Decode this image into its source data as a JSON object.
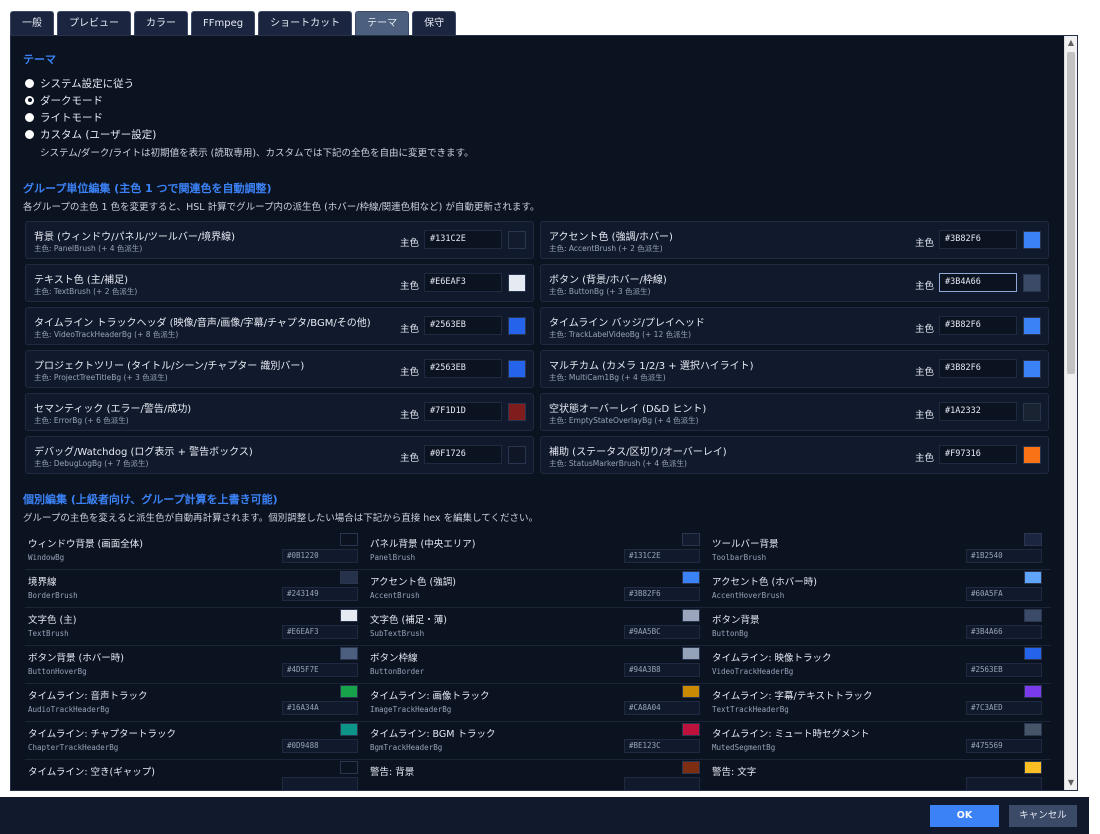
{
  "tabs": [
    {
      "label": "一般"
    },
    {
      "label": "プレビュー"
    },
    {
      "label": "カラー"
    },
    {
      "label": "FFmpeg"
    },
    {
      "label": "ショートカット"
    },
    {
      "label": "テーマ",
      "active": true
    },
    {
      "label": "保守"
    }
  ],
  "theme": {
    "title": "テーマ",
    "options": [
      {
        "label": "システム設定に従う",
        "checked": false
      },
      {
        "label": "ダークモード",
        "checked": true
      },
      {
        "label": "ライトモード",
        "checked": false
      },
      {
        "label": "カスタム (ユーザー設定)",
        "checked": false
      }
    ],
    "note": "システム/ダーク/ライトは初期値を表示 (読取専用)、カスタムでは下記の全色を自由に変更できます。"
  },
  "group_edit": {
    "title": "グループ単位編集 (主色 1 つで関連色を自動調整)",
    "desc": "各グループの主色 1 色を変更すると、HSL 計算でグループ内の派生色 (ホバー/枠線/関連色相など) が自動更新されます。",
    "primary_label": "主色",
    "groups": [
      {
        "title": "背景 (ウィンドウ/パネル/ツールバー/境界線)",
        "sub": "主色: PanelBrush (+ 4 色派生)",
        "hex": "#131C2E",
        "color": "#131C2E"
      },
      {
        "title": "アクセント色 (強調/ホバー)",
        "sub": "主色: AccentBrush (+ 2 色派生)",
        "hex": "#3B82F6",
        "color": "#3B82F6"
      },
      {
        "title": "テキスト色 (主/補足)",
        "sub": "主色: TextBrush (+ 2 色派生)",
        "hex": "#E6EAF3",
        "color": "#E6EAF3"
      },
      {
        "title": "ボタン (背景/ホバー/枠線)",
        "sub": "主色: ButtonBg (+ 3 色派生)",
        "hex": "#3B4A66",
        "color": "#3B4A66",
        "focused": true
      },
      {
        "title": "タイムライン トラックヘッダ (映像/音声/画像/字幕/チャプタ/BGM/その他)",
        "sub": "主色: VideoTrackHeaderBg (+ 8 色派生)",
        "hex": "#2563EB",
        "color": "#2563EB"
      },
      {
        "title": "タイムライン バッジ/プレイヘッド",
        "sub": "主色: TrackLabelVideoBg (+ 12 色派生)",
        "hex": "#3B82F6",
        "color": "#3B82F6"
      },
      {
        "title": "プロジェクトツリー (タイトル/シーン/チャプター 識別バー)",
        "sub": "主色: ProjectTreeTitleBg (+ 3 色派生)",
        "hex": "#2563EB",
        "color": "#2563EB"
      },
      {
        "title": "マルチカム (カメラ 1/2/3 + 選択ハイライト)",
        "sub": "主色: MultiCam1Bg (+ 4 色派生)",
        "hex": "#3B82F6",
        "color": "#3B82F6"
      },
      {
        "title": "セマンティック (エラー/警告/成功)",
        "sub": "主色: ErrorBg (+ 6 色派生)",
        "hex": "#7F1D1D",
        "color": "#7F1D1D"
      },
      {
        "title": "空状態オーバーレイ (D&D ヒント)",
        "sub": "主色: EmptyStateOverlayBg (+ 4 色派生)",
        "hex": "#1A2332",
        "color": "#1A2332"
      },
      {
        "title": "デバッグ/Watchdog (ログ表示 + 警告ボックス)",
        "sub": "主色: DebugLogBg (+ 7 色派生)",
        "hex": "#0F1726",
        "color": "#0F1726"
      },
      {
        "title": "補助 (ステータス/区切り/オーバーレイ)",
        "sub": "主色: StatusMarkerBrush (+ 4 色派生)",
        "hex": "#F97316",
        "color": "#F97316"
      }
    ]
  },
  "individual": {
    "title": "個別編集 (上級者向け、グループ計算を上書き可能)",
    "desc": "グループの主色を変えると派生色が自動再計算されます。個別調整したい場合は下記から直接 hex を編集してください。",
    "items": [
      {
        "name": "ウィンドウ背景 (画面全体)",
        "key": "WindowBg",
        "hex": "#0B1220",
        "color": "#0B1220"
      },
      {
        "name": "パネル背景 (中央エリア)",
        "key": "PanelBrush",
        "hex": "#131C2E",
        "color": "#131C2E"
      },
      {
        "name": "ツールバー背景",
        "key": "ToolbarBrush",
        "hex": "#1B2540",
        "color": "#1B2540"
      },
      {
        "name": "境界線",
        "key": "BorderBrush",
        "hex": "#243149",
        "color": "#243149"
      },
      {
        "name": "アクセント色 (強調)",
        "key": "AccentBrush",
        "hex": "#3B82F6",
        "color": "#3B82F6"
      },
      {
        "name": "アクセント色 (ホバー時)",
        "key": "AccentHoverBrush",
        "hex": "#60A5FA",
        "color": "#60A5FA"
      },
      {
        "name": "文字色 (主)",
        "key": "TextBrush",
        "hex": "#E6EAF3",
        "color": "#E6EAF3"
      },
      {
        "name": "文字色 (補足・薄)",
        "key": "SubTextBrush",
        "hex": "#9AA5BC",
        "color": "#9AA5BC"
      },
      {
        "name": "ボタン背景",
        "key": "ButtonBg",
        "hex": "#3B4A66",
        "color": "#3B4A66"
      },
      {
        "name": "ボタン背景 (ホバー時)",
        "key": "ButtonHoverBg",
        "hex": "#4D5F7E",
        "color": "#4D5F7E"
      },
      {
        "name": "ボタン枠線",
        "key": "ButtonBorder",
        "hex": "#94A3B8",
        "color": "#94A3B8"
      },
      {
        "name": "タイムライン: 映像トラック",
        "key": "VideoTrackHeaderBg",
        "hex": "#2563EB",
        "color": "#2563EB"
      },
      {
        "name": "タイムライン: 音声トラック",
        "key": "AudioTrackHeaderBg",
        "hex": "#16A34A",
        "color": "#16A34A"
      },
      {
        "name": "タイムライン: 画像トラック",
        "key": "ImageTrackHeaderBg",
        "hex": "#CA8A04",
        "color": "#CA8A04"
      },
      {
        "name": "タイムライン: 字幕/テキストトラック",
        "key": "TextTrackHeaderBg",
        "hex": "#7C3AED",
        "color": "#7C3AED"
      },
      {
        "name": "タイムライン: チャプタートラック",
        "key": "ChapterTrackHeaderBg",
        "hex": "#0D9488",
        "color": "#0D9488"
      },
      {
        "name": "タイムライン: BGM トラック",
        "key": "BgmTrackHeaderBg",
        "hex": "#BE123C",
        "color": "#BE123C"
      },
      {
        "name": "タイムライン: ミュート時セグメント",
        "key": "MutedSegmentBg",
        "hex": "#475569",
        "color": "#475569"
      },
      {
        "name": "タイムライン: 空き(ギャップ)",
        "key": "",
        "hex": "",
        "color": "#0B1220"
      },
      {
        "name": "警告: 背景",
        "key": "",
        "hex": "",
        "color": "#7C2D12"
      },
      {
        "name": "警告: 文字",
        "key": "",
        "hex": "",
        "color": "#FBBF24"
      }
    ]
  },
  "footer": {
    "ok_label": "OK",
    "cancel_label": "キャンセル"
  }
}
